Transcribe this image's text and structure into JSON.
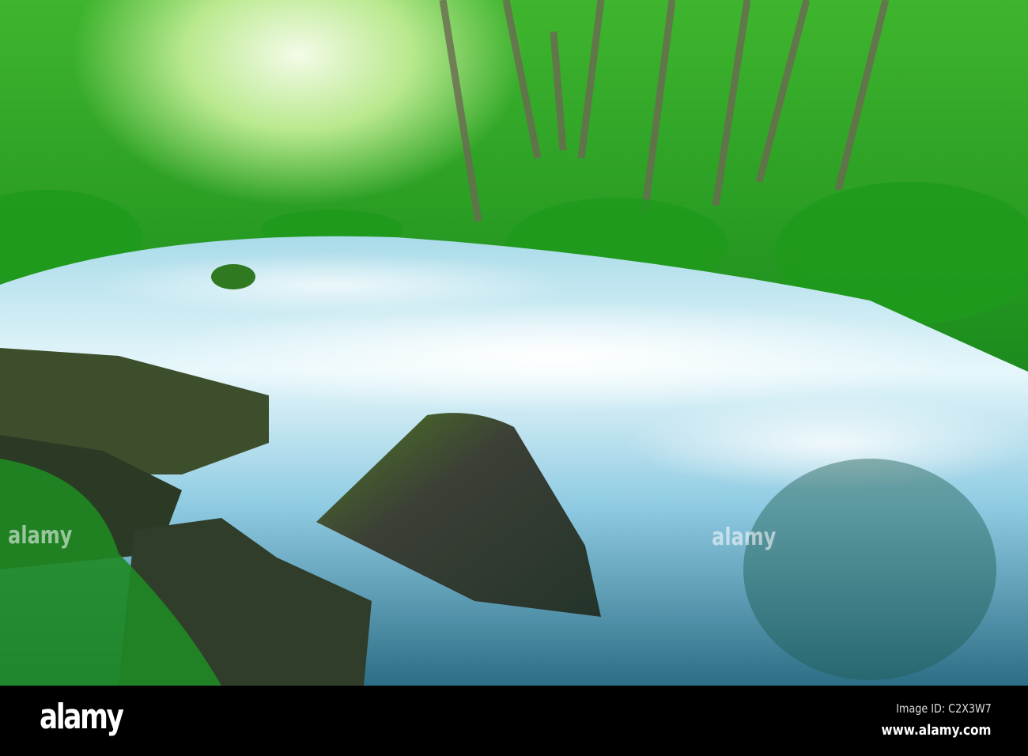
{
  "photo": {
    "subject": "forest-river-rapids",
    "colors": {
      "foliage": "#2fae2a",
      "water": "#bfe8f5",
      "rock": "#3a3d33",
      "moss": "#4c8a1c"
    }
  },
  "watermark": {
    "text": "alamy"
  },
  "footer": {
    "logo": "alamy",
    "image_id": "Image ID: C2X3W7",
    "website": "www.alamy.com"
  }
}
